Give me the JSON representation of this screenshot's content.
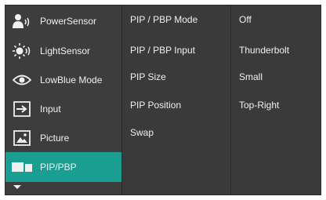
{
  "main_menu": [
    {
      "label": "PowerSensor",
      "icon": "power-sensor-icon"
    },
    {
      "label": "LightSensor",
      "icon": "light-sensor-icon"
    },
    {
      "label": "LowBlue Mode",
      "icon": "eye-icon"
    },
    {
      "label": "Input",
      "icon": "input-icon"
    },
    {
      "label": "Picture",
      "icon": "picture-icon"
    },
    {
      "label": "PIP/PBP",
      "icon": "pip-pbp-icon",
      "selected": true
    }
  ],
  "more_indicator": "chevron-down-icon",
  "submenu": [
    {
      "label": "PIP / PBP Mode"
    },
    {
      "label": "PIP / PBP Input"
    },
    {
      "label": "PIP Size"
    },
    {
      "label": "PIP Position"
    },
    {
      "label": "Swap"
    }
  ],
  "values": [
    {
      "label": "Off"
    },
    {
      "label": "Thunderbolt"
    },
    {
      "label": "Small"
    },
    {
      "label": "Top-Right"
    }
  ],
  "colors": {
    "background": "#3d3d3d",
    "selected": "#1b9e92",
    "text": "#f0f0f0"
  }
}
